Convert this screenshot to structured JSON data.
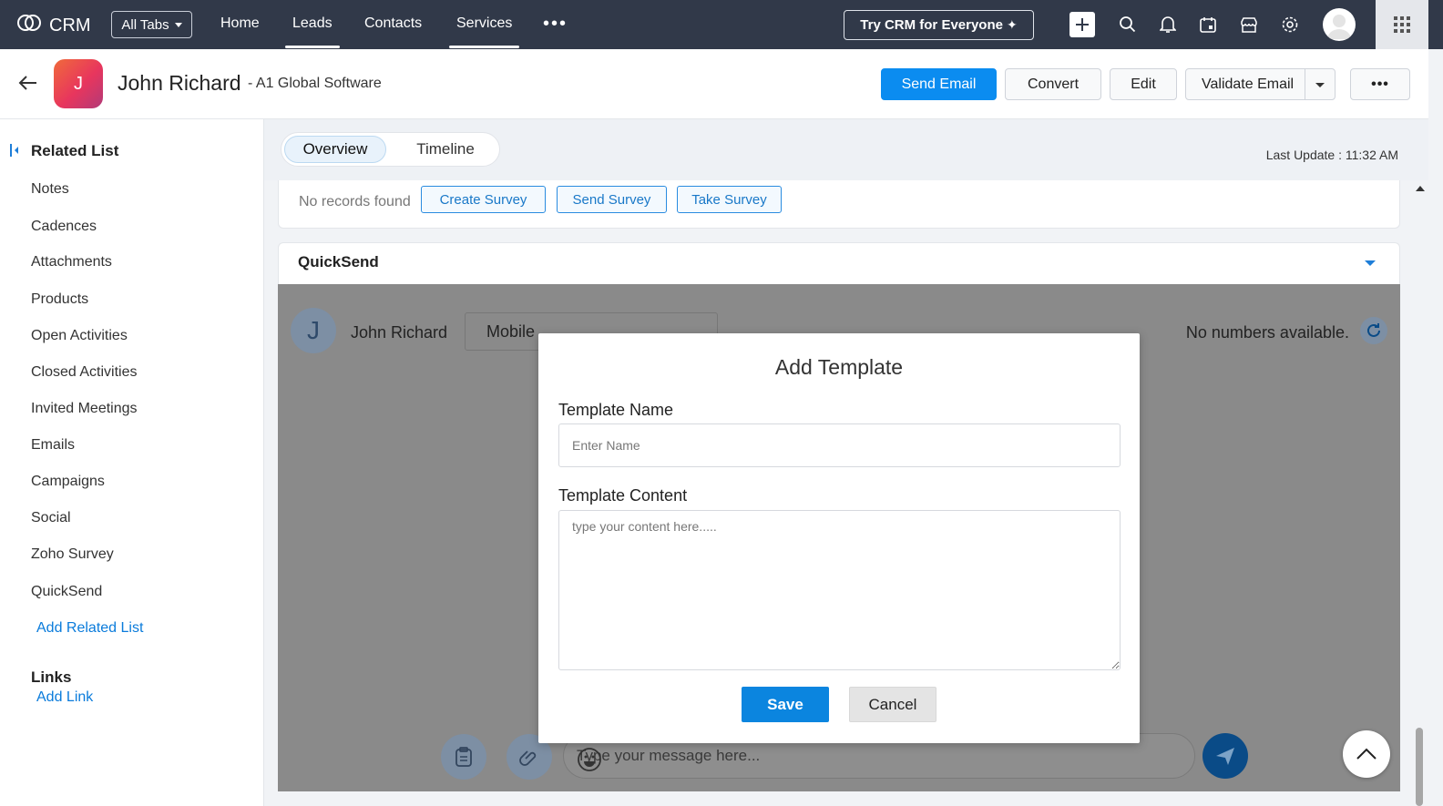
{
  "topnav": {
    "brand": "CRM",
    "all_tabs": "All Tabs",
    "links": [
      "Home",
      "Leads",
      "Contacts",
      "Services"
    ],
    "active_link": "Leads",
    "more": "•••",
    "try_crm": "Try CRM for Everyone",
    "icons": [
      "plus-icon",
      "search-icon",
      "bell-icon",
      "calendar-icon",
      "store-icon",
      "gear-icon",
      "user-avatar",
      "apps-grid-icon"
    ]
  },
  "header": {
    "avatar_letter": "J",
    "name": "John Richard",
    "company": "- A1 Global Software",
    "buttons": {
      "send_email": "Send Email",
      "convert": "Convert",
      "edit": "Edit",
      "validate_email": "Validate Email",
      "more": "•••"
    }
  },
  "sidebar": {
    "title": "Related List",
    "items": [
      "Notes",
      "Cadences",
      "Attachments",
      "Products",
      "Open Activities",
      "Closed Activities",
      "Invited Meetings",
      "Emails",
      "Campaigns",
      "Social",
      "Zoho Survey",
      "QuickSend"
    ],
    "add_related": "Add Related List",
    "links_title": "Links",
    "add_link": "Add Link"
  },
  "tabs": {
    "overview": "Overview",
    "timeline": "Timeline",
    "active": "Overview",
    "last_update": "Last Update : 11:32 AM"
  },
  "survey": {
    "no_records": "No records found",
    "create": "Create Survey",
    "send": "Send Survey",
    "take": "Take Survey"
  },
  "quicksend": {
    "title": "QuickSend",
    "avatar_letter": "J",
    "contact_name": "John Richard",
    "phone_select": "Mobile",
    "no_numbers": "No numbers available.",
    "message_placeholder": "Type your message here..."
  },
  "modal": {
    "title": "Add Template",
    "name_label": "Template Name",
    "name_placeholder": "Enter Name",
    "content_label": "Template Content",
    "content_placeholder": "type your content here.....",
    "save": "Save",
    "cancel": "Cancel"
  },
  "colors": {
    "nav_bg": "#313949",
    "primary": "#0b8cf0",
    "link": "#0a7bdb",
    "overlay": "#8a8a8a"
  }
}
